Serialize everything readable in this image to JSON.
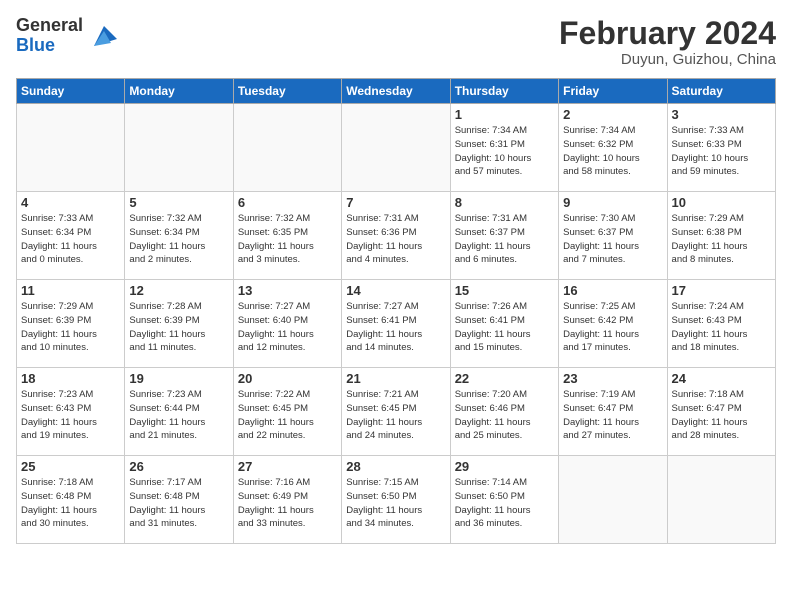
{
  "header": {
    "logo_general": "General",
    "logo_blue": "Blue",
    "month_title": "February 2024",
    "location": "Duyun, Guizhou, China"
  },
  "days_of_week": [
    "Sunday",
    "Monday",
    "Tuesday",
    "Wednesday",
    "Thursday",
    "Friday",
    "Saturday"
  ],
  "weeks": [
    [
      {
        "day": "",
        "info": ""
      },
      {
        "day": "",
        "info": ""
      },
      {
        "day": "",
        "info": ""
      },
      {
        "day": "",
        "info": ""
      },
      {
        "day": "1",
        "info": "Sunrise: 7:34 AM\nSunset: 6:31 PM\nDaylight: 10 hours\nand 57 minutes."
      },
      {
        "day": "2",
        "info": "Sunrise: 7:34 AM\nSunset: 6:32 PM\nDaylight: 10 hours\nand 58 minutes."
      },
      {
        "day": "3",
        "info": "Sunrise: 7:33 AM\nSunset: 6:33 PM\nDaylight: 10 hours\nand 59 minutes."
      }
    ],
    [
      {
        "day": "4",
        "info": "Sunrise: 7:33 AM\nSunset: 6:34 PM\nDaylight: 11 hours\nand 0 minutes."
      },
      {
        "day": "5",
        "info": "Sunrise: 7:32 AM\nSunset: 6:34 PM\nDaylight: 11 hours\nand 2 minutes."
      },
      {
        "day": "6",
        "info": "Sunrise: 7:32 AM\nSunset: 6:35 PM\nDaylight: 11 hours\nand 3 minutes."
      },
      {
        "day": "7",
        "info": "Sunrise: 7:31 AM\nSunset: 6:36 PM\nDaylight: 11 hours\nand 4 minutes."
      },
      {
        "day": "8",
        "info": "Sunrise: 7:31 AM\nSunset: 6:37 PM\nDaylight: 11 hours\nand 6 minutes."
      },
      {
        "day": "9",
        "info": "Sunrise: 7:30 AM\nSunset: 6:37 PM\nDaylight: 11 hours\nand 7 minutes."
      },
      {
        "day": "10",
        "info": "Sunrise: 7:29 AM\nSunset: 6:38 PM\nDaylight: 11 hours\nand 8 minutes."
      }
    ],
    [
      {
        "day": "11",
        "info": "Sunrise: 7:29 AM\nSunset: 6:39 PM\nDaylight: 11 hours\nand 10 minutes."
      },
      {
        "day": "12",
        "info": "Sunrise: 7:28 AM\nSunset: 6:39 PM\nDaylight: 11 hours\nand 11 minutes."
      },
      {
        "day": "13",
        "info": "Sunrise: 7:27 AM\nSunset: 6:40 PM\nDaylight: 11 hours\nand 12 minutes."
      },
      {
        "day": "14",
        "info": "Sunrise: 7:27 AM\nSunset: 6:41 PM\nDaylight: 11 hours\nand 14 minutes."
      },
      {
        "day": "15",
        "info": "Sunrise: 7:26 AM\nSunset: 6:41 PM\nDaylight: 11 hours\nand 15 minutes."
      },
      {
        "day": "16",
        "info": "Sunrise: 7:25 AM\nSunset: 6:42 PM\nDaylight: 11 hours\nand 17 minutes."
      },
      {
        "day": "17",
        "info": "Sunrise: 7:24 AM\nSunset: 6:43 PM\nDaylight: 11 hours\nand 18 minutes."
      }
    ],
    [
      {
        "day": "18",
        "info": "Sunrise: 7:23 AM\nSunset: 6:43 PM\nDaylight: 11 hours\nand 19 minutes."
      },
      {
        "day": "19",
        "info": "Sunrise: 7:23 AM\nSunset: 6:44 PM\nDaylight: 11 hours\nand 21 minutes."
      },
      {
        "day": "20",
        "info": "Sunrise: 7:22 AM\nSunset: 6:45 PM\nDaylight: 11 hours\nand 22 minutes."
      },
      {
        "day": "21",
        "info": "Sunrise: 7:21 AM\nSunset: 6:45 PM\nDaylight: 11 hours\nand 24 minutes."
      },
      {
        "day": "22",
        "info": "Sunrise: 7:20 AM\nSunset: 6:46 PM\nDaylight: 11 hours\nand 25 minutes."
      },
      {
        "day": "23",
        "info": "Sunrise: 7:19 AM\nSunset: 6:47 PM\nDaylight: 11 hours\nand 27 minutes."
      },
      {
        "day": "24",
        "info": "Sunrise: 7:18 AM\nSunset: 6:47 PM\nDaylight: 11 hours\nand 28 minutes."
      }
    ],
    [
      {
        "day": "25",
        "info": "Sunrise: 7:18 AM\nSunset: 6:48 PM\nDaylight: 11 hours\nand 30 minutes."
      },
      {
        "day": "26",
        "info": "Sunrise: 7:17 AM\nSunset: 6:48 PM\nDaylight: 11 hours\nand 31 minutes."
      },
      {
        "day": "27",
        "info": "Sunrise: 7:16 AM\nSunset: 6:49 PM\nDaylight: 11 hours\nand 33 minutes."
      },
      {
        "day": "28",
        "info": "Sunrise: 7:15 AM\nSunset: 6:50 PM\nDaylight: 11 hours\nand 34 minutes."
      },
      {
        "day": "29",
        "info": "Sunrise: 7:14 AM\nSunset: 6:50 PM\nDaylight: 11 hours\nand 36 minutes."
      },
      {
        "day": "",
        "info": ""
      },
      {
        "day": "",
        "info": ""
      }
    ]
  ]
}
